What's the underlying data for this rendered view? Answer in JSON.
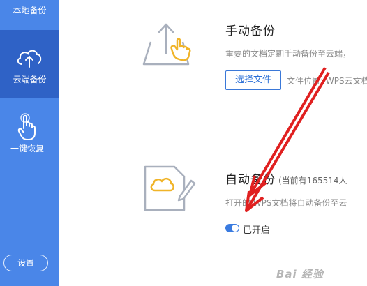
{
  "sidebar": {
    "items": [
      {
        "label": "本地备份"
      },
      {
        "label": "云端备份"
      },
      {
        "label": "一键恢复"
      }
    ],
    "settings_label": "设置"
  },
  "manual": {
    "title": "手动备份",
    "description": "重要的文档定期手动备份至云端，",
    "select_label": "选择文件",
    "location_text": "文件位置: WPS云文档/"
  },
  "auto": {
    "title": "自动备份",
    "subtitle": "(当前有165514人",
    "description": "打开的 WPS文档将自动备份至云",
    "toggle_label": "已开启",
    "toggle_on": true
  },
  "watermark": "Bai 经验",
  "colors": {
    "sidebar": "#4a86e8",
    "sidebar_active": "#2f62c6",
    "accent": "#3a7be0",
    "arrow": "#e02020"
  }
}
